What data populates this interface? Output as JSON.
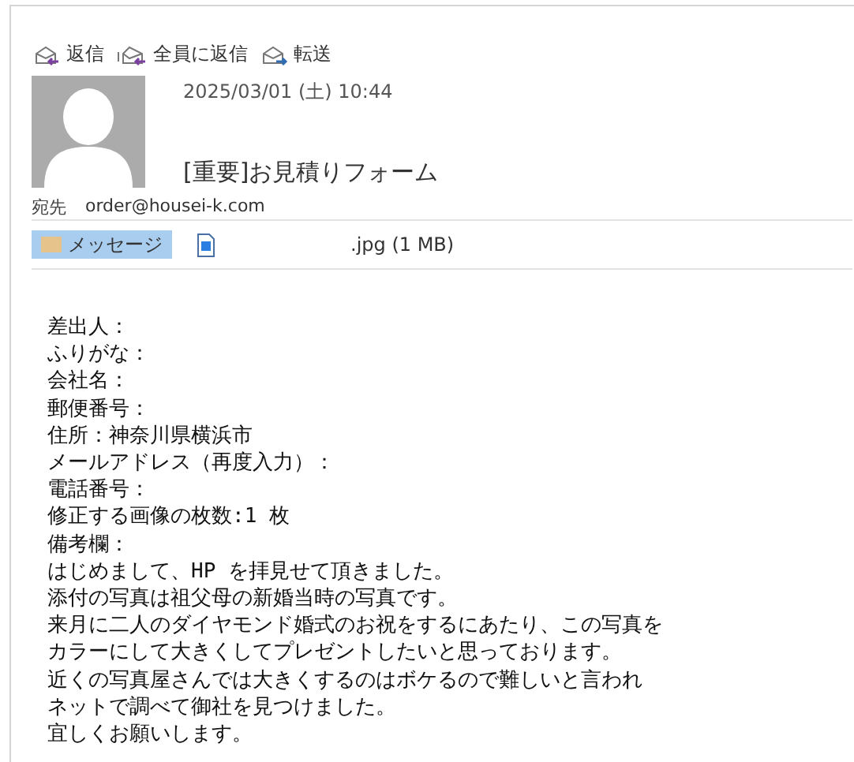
{
  "toolbar": [
    {
      "kind": "reply",
      "label": "返信"
    },
    {
      "kind": "reply_all",
      "label": "全員に返信"
    },
    {
      "kind": "forward",
      "label": "転送"
    }
  ],
  "message": {
    "date": "2025/03/01 (土) 10:44",
    "subject": "[重要]お見積りフォーム",
    "to_label": "宛先",
    "to": "order@housei-k.com"
  },
  "attachments": [
    {
      "kind": "message",
      "label": "メッセージ",
      "selected": true
    },
    {
      "kind": "file",
      "label": ".jpg (1 MB)",
      "selected": false
    }
  ],
  "body": [
    "差出人：",
    "ふりがな：",
    "会社名：",
    "郵便番号：",
    "住所：神奈川県横浜市",
    "メールアドレス（再度入力）：",
    "電話番号：",
    "修正する画像の枚数:1 枚",
    "備考欄：",
    "はじめまして、HP を拝見せて頂きました。",
    "添付の写真は祖父母の新婚当時の写真です。",
    "来月に二人のダイヤモンド婚式のお祝をするにあたり、この写真を",
    "カラーにして大きくしてプレゼントしたいと思っております。",
    "近くの写真屋さんでは大きくするのはボケるので難しいと言われ",
    "ネットで調べて御社を見つけました。",
    "宜しくお願いします。"
  ]
}
